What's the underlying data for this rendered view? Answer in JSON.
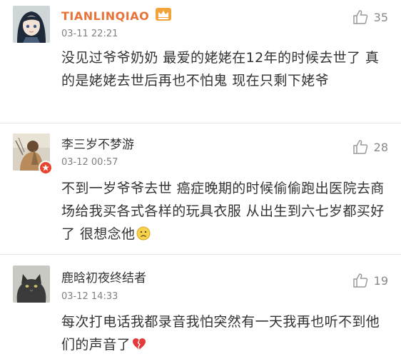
{
  "comments": [
    {
      "username": "TIANLINQIAO",
      "time": "03-11 22:21",
      "likes": "35",
      "text": "没见过爷爷奶奶 最爱的姥姥在12年的时候去世了 真的是姥姥去世后再也不怕鬼 现在只剩下姥爷",
      "avatar_icon": "anime-girl-avatar",
      "badge_icon": "crown-icon"
    },
    {
      "username": "李三岁不梦游",
      "time": "03-12 00:57",
      "likes": "28",
      "text": "不到一岁爷爷去世 癌症晚期的时候偷偷跑出医院去商场给我买各式各样的玩具衣服 从出生到六七岁都买好了 很想念他",
      "avatar_icon": "person-photo-avatar",
      "emoji": "sad-face-emoji"
    },
    {
      "username": "鹿晗初夜终结者",
      "time": "03-12 14:33",
      "likes": "19",
      "text": "每次打电话我都录音我怕突然有一天我再也听不到他们的声音了",
      "avatar_icon": "cat-avatar",
      "emoji": "broken-heart-emoji"
    }
  ],
  "colors": {
    "vip_username": "#e8743a",
    "text": "#333333",
    "meta": "#808080",
    "divider": "#e6e6e6"
  }
}
